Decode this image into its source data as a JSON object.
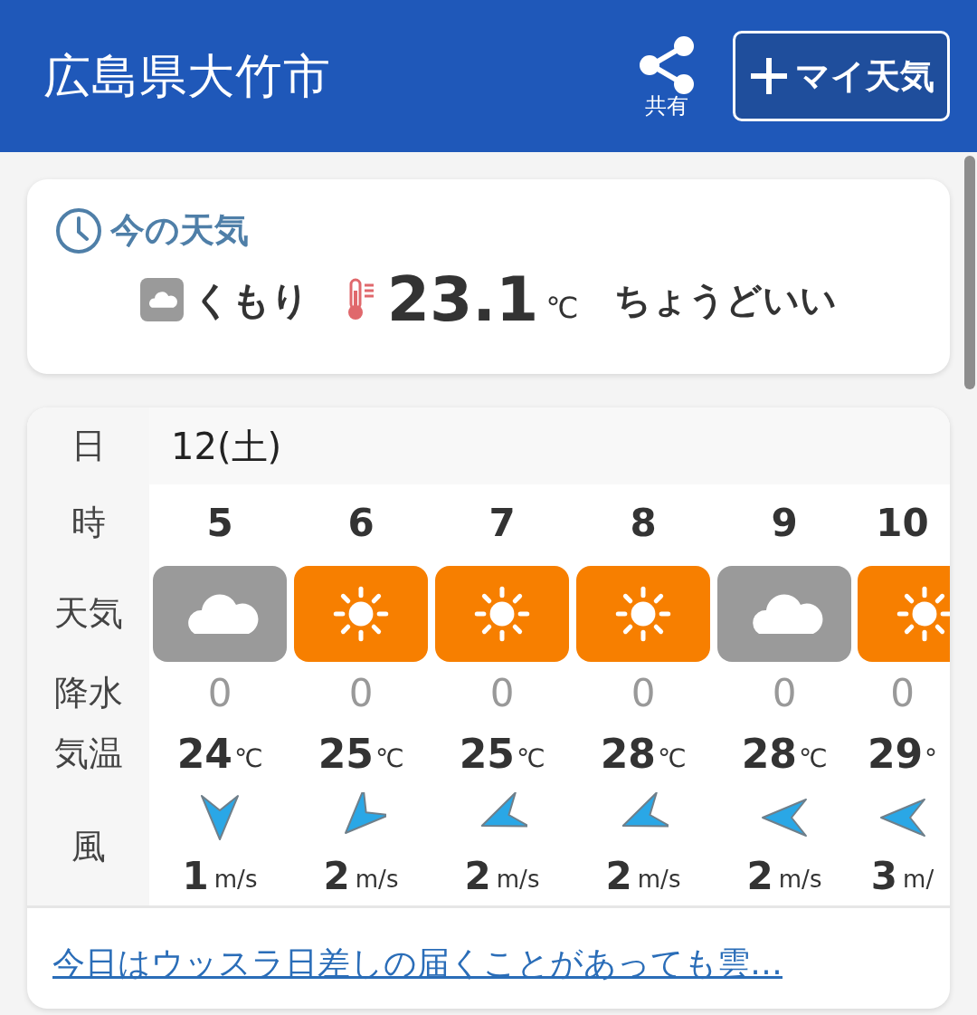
{
  "header": {
    "title": "広島県大竹市",
    "share_label": "共有",
    "my_weather_button": "マイ天気"
  },
  "current": {
    "heading": "今の天気",
    "kind": "cloudy",
    "condition": "くもり",
    "temperature": "23.1",
    "unit": "℃",
    "comment": "ちょうどいい"
  },
  "forecast": {
    "row_labels": {
      "date": "日",
      "hour": "時",
      "weather": "天気",
      "precipitation": "降水",
      "temperature": "気温",
      "wind": "風"
    },
    "date": "12(土)",
    "hours": [
      {
        "hour": "5",
        "kind": "cloudy",
        "precipitation": "0",
        "temperature": "24",
        "temp_unit": "℃",
        "wind_arrow": {
          "kind": "n"
        },
        "wind_speed": "1",
        "wind_unit": "m/s"
      },
      {
        "hour": "6",
        "kind": "sunny",
        "precipitation": "0",
        "temperature": "25",
        "temp_unit": "℃",
        "wind_arrow": {
          "kind": "ne"
        },
        "wind_speed": "2",
        "wind_unit": "m/s"
      },
      {
        "hour": "7",
        "kind": "sunny",
        "precipitation": "0",
        "temperature": "25",
        "temp_unit": "℃",
        "wind_arrow": {
          "kind": "ene"
        },
        "wind_speed": "2",
        "wind_unit": "m/s"
      },
      {
        "hour": "8",
        "kind": "sunny",
        "precipitation": "0",
        "temperature": "28",
        "temp_unit": "℃",
        "wind_arrow": {
          "kind": "ene"
        },
        "wind_speed": "2",
        "wind_unit": "m/s"
      },
      {
        "hour": "9",
        "kind": "cloudy",
        "precipitation": "0",
        "temperature": "28",
        "temp_unit": "℃",
        "wind_arrow": {
          "kind": "e"
        },
        "wind_speed": "2",
        "wind_unit": "m/s"
      },
      {
        "hour": "10",
        "kind": "sunny",
        "precipitation": "0",
        "temperature": "29",
        "temp_unit": "°",
        "wind_arrow": {
          "kind": "e"
        },
        "wind_speed": "3",
        "wind_unit": "m/"
      }
    ],
    "summary_link": "今日はウッスラ日差しの届くことがあっても雲…"
  }
}
